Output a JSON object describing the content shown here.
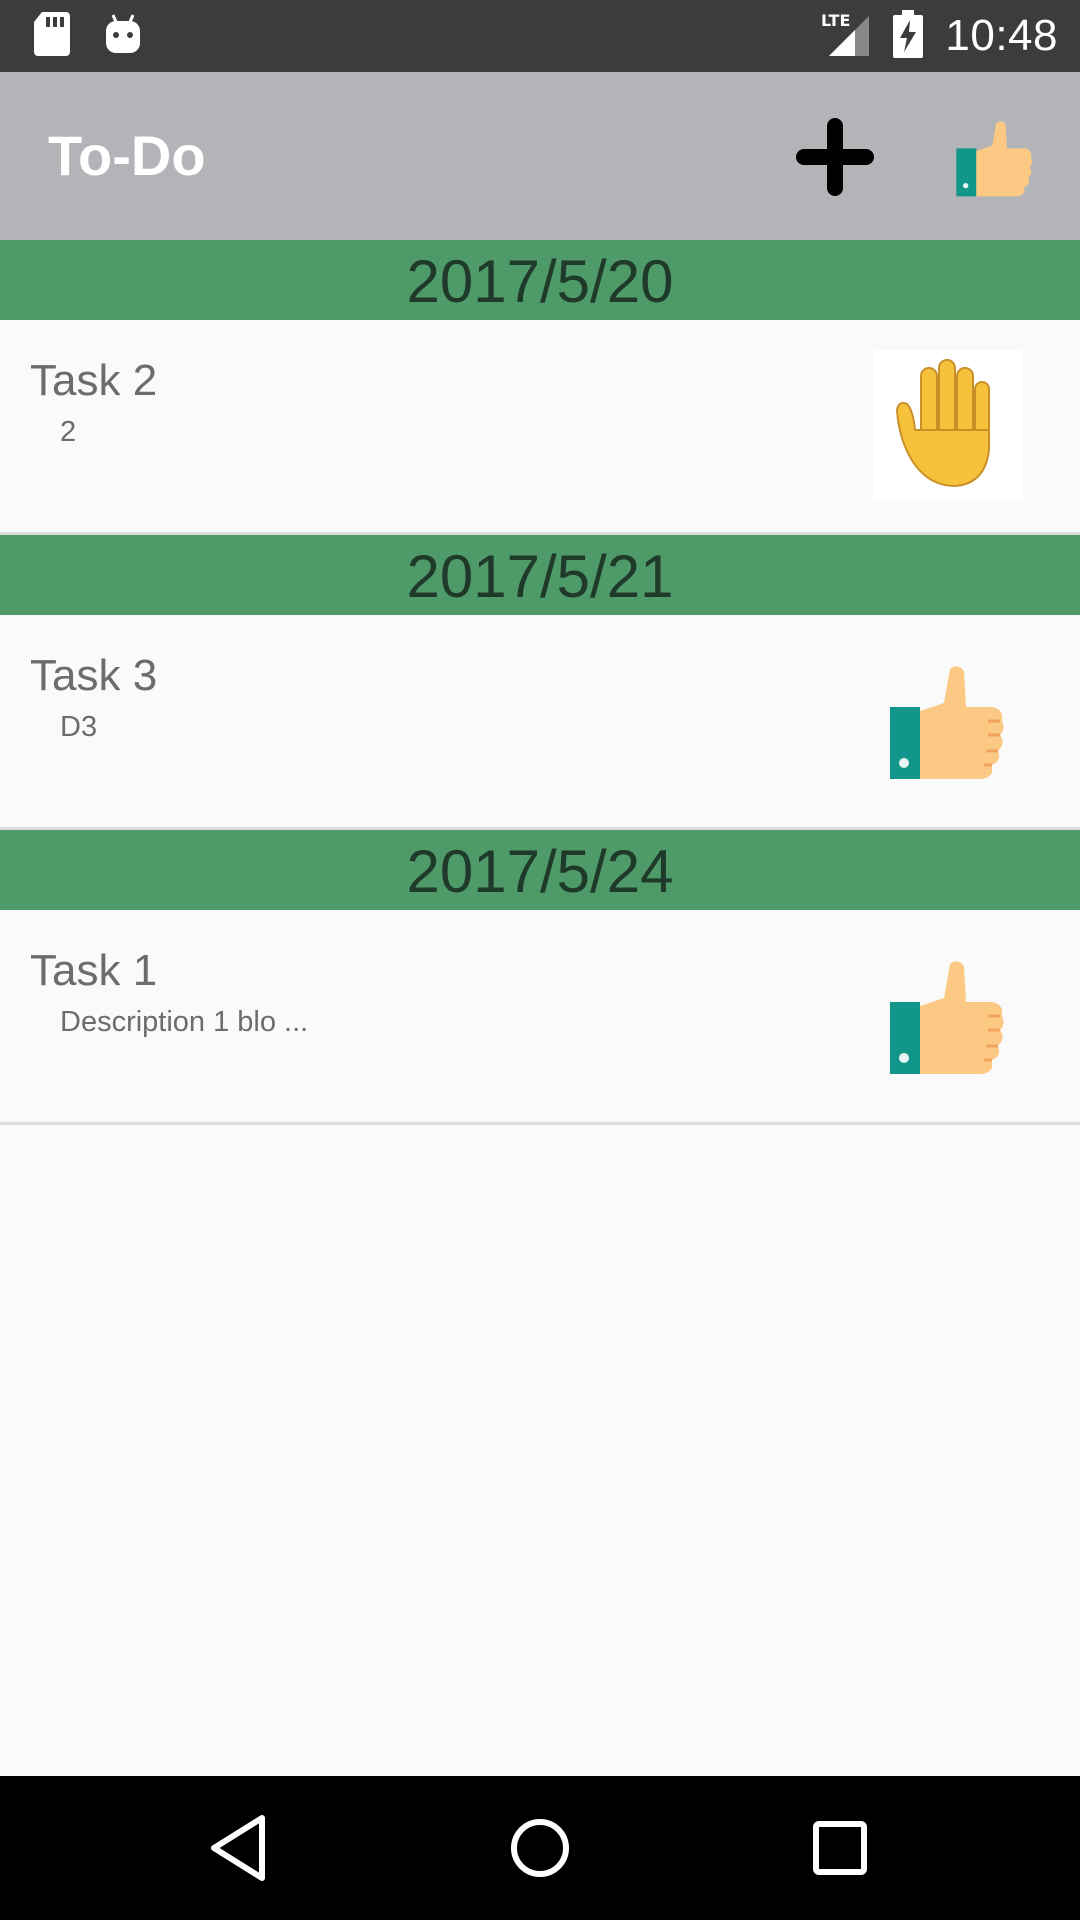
{
  "status_bar": {
    "network": "LTE",
    "time": "10:48"
  },
  "app_bar": {
    "title": "To-Do",
    "add_icon": "plus-icon",
    "done_icon": "thumbs-up-icon"
  },
  "sections": [
    {
      "date": "2017/5/20",
      "task": {
        "title": "Task 2",
        "description": "2",
        "status_icon": "raised-hand-icon"
      }
    },
    {
      "date": "2017/5/21",
      "task": {
        "title": "Task 3",
        "description": "D3",
        "status_icon": "thumbs-up-icon"
      }
    },
    {
      "date": "2017/5/24",
      "task": {
        "title": "Task 1",
        "description": "Description 1 blo ...",
        "status_icon": "thumbs-up-icon"
      }
    }
  ],
  "colors": {
    "status_bar": "#3c3c3e",
    "app_bar": "#b3b4b8",
    "date_header": "#4e9a68",
    "background": "#fafafa",
    "nav_bar": "#000000"
  }
}
